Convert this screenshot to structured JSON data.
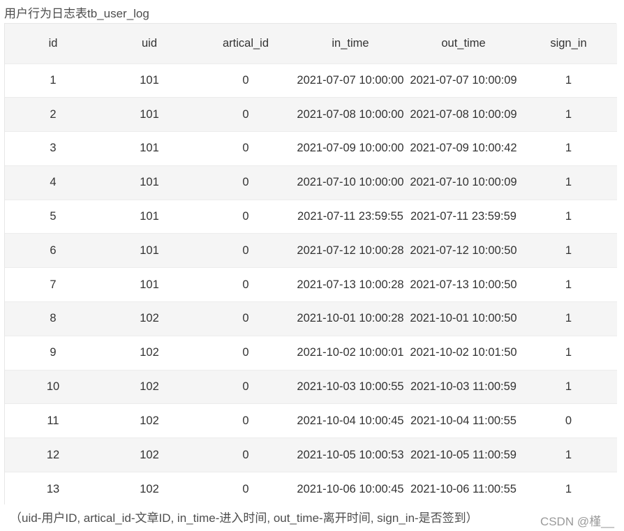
{
  "caption": "用户行为日志表tb_user_log",
  "table": {
    "headers": [
      "id",
      "uid",
      "artical_id",
      "in_time",
      "out_time",
      "sign_in"
    ],
    "rows": [
      [
        "1",
        "101",
        "0",
        "2021-07-07 10:00:00",
        "2021-07-07 10:00:09",
        "1"
      ],
      [
        "2",
        "101",
        "0",
        "2021-07-08 10:00:00",
        "2021-07-08 10:00:09",
        "1"
      ],
      [
        "3",
        "101",
        "0",
        "2021-07-09 10:00:00",
        "2021-07-09 10:00:42",
        "1"
      ],
      [
        "4",
        "101",
        "0",
        "2021-07-10 10:00:00",
        "2021-07-10 10:00:09",
        "1"
      ],
      [
        "5",
        "101",
        "0",
        "2021-07-11 23:59:55",
        "2021-07-11 23:59:59",
        "1"
      ],
      [
        "6",
        "101",
        "0",
        "2021-07-12 10:00:28",
        "2021-07-12 10:00:50",
        "1"
      ],
      [
        "7",
        "101",
        "0",
        "2021-07-13 10:00:28",
        "2021-07-13 10:00:50",
        "1"
      ],
      [
        "8",
        "102",
        "0",
        "2021-10-01 10:00:28",
        "2021-10-01 10:00:50",
        "1"
      ],
      [
        "9",
        "102",
        "0",
        "2021-10-02 10:00:01",
        "2021-10-02 10:01:50",
        "1"
      ],
      [
        "10",
        "102",
        "0",
        "2021-10-03 10:00:55",
        "2021-10-03 11:00:59",
        "1"
      ],
      [
        "11",
        "102",
        "0",
        "2021-10-04 10:00:45",
        "2021-10-04 11:00:55",
        "0"
      ],
      [
        "12",
        "102",
        "0",
        "2021-10-05 10:00:53",
        "2021-10-05 11:00:59",
        "1"
      ],
      [
        "13",
        "102",
        "0",
        "2021-10-06 10:00:45",
        "2021-10-06 11:00:55",
        "1"
      ]
    ]
  },
  "note": "（uid-用户ID, artical_id-文章ID, in_time-进入时间, out_time-离开时间, sign_in-是否签到）",
  "watermark": "CSDN @槿__"
}
